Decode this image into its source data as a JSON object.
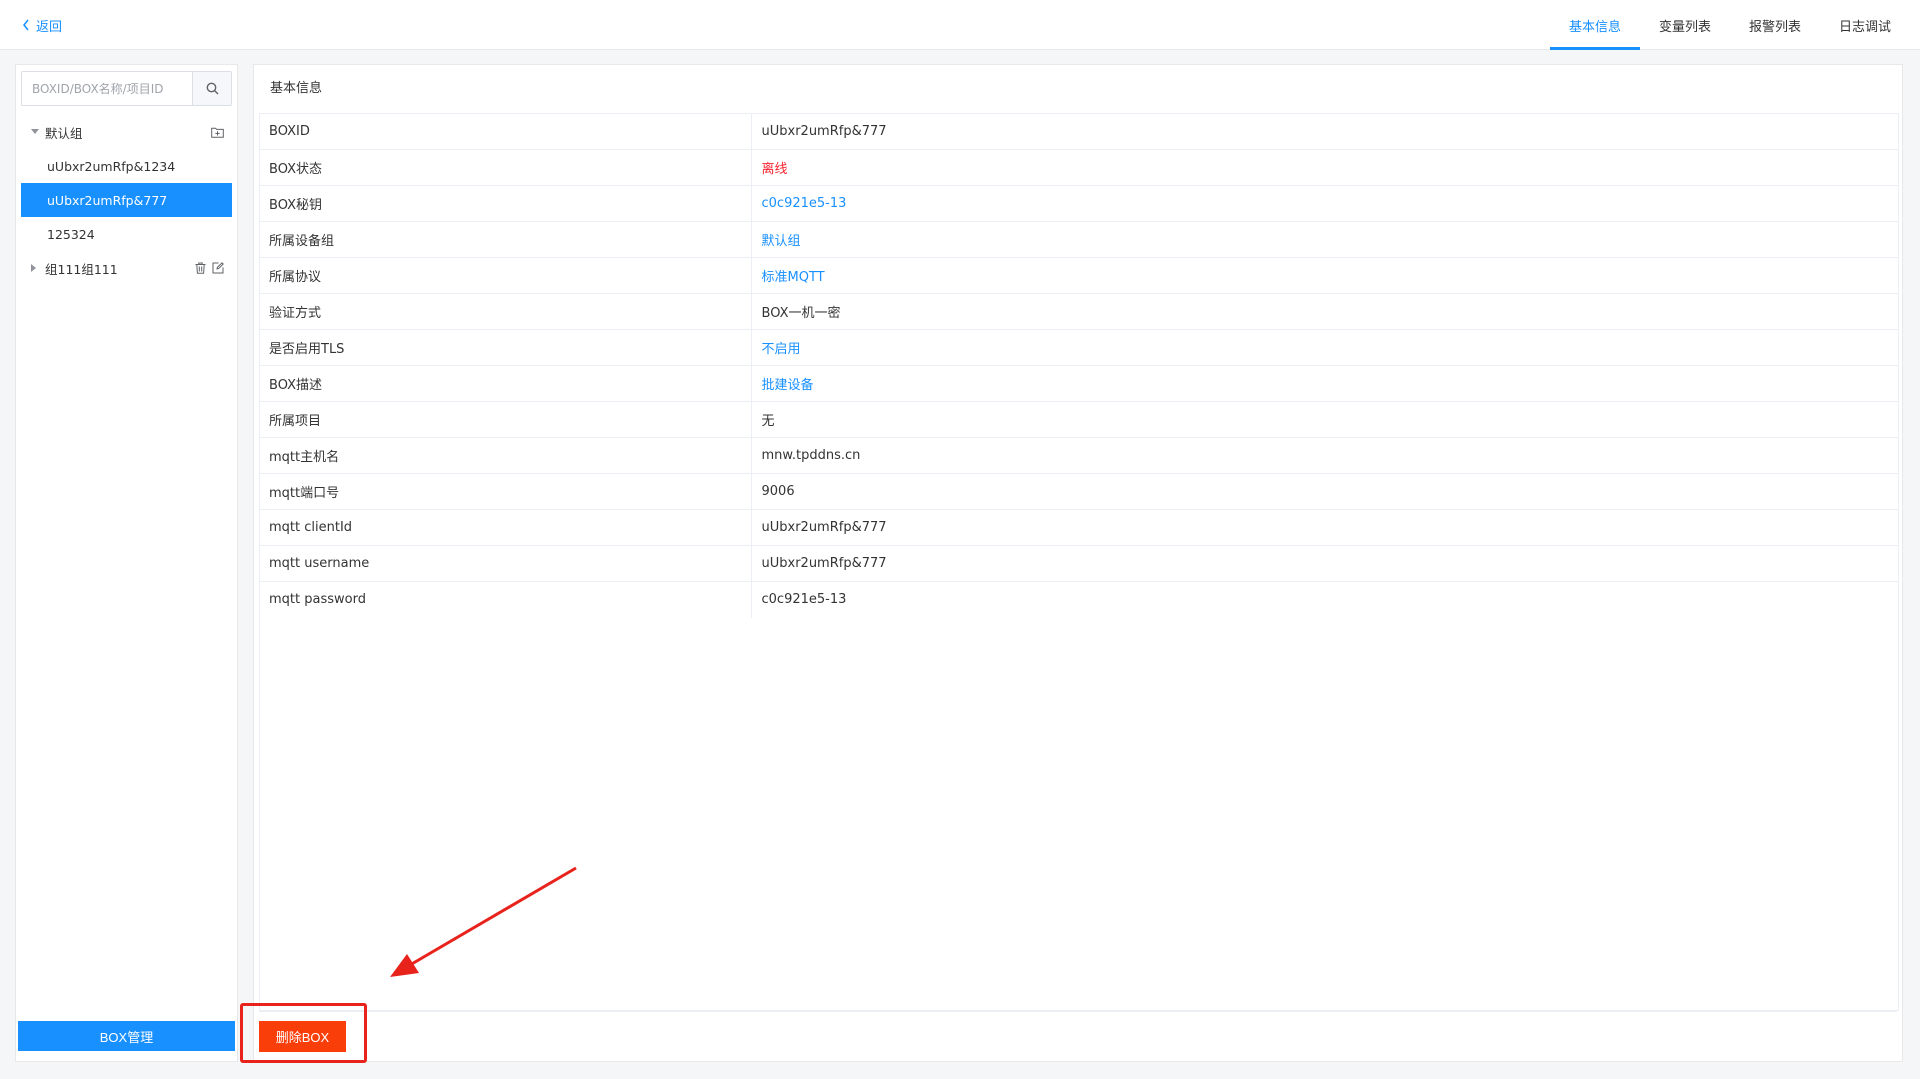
{
  "header": {
    "back_label": "返回",
    "tabs": [
      {
        "label": "基本信息",
        "active": true
      },
      {
        "label": "变量列表",
        "active": false
      },
      {
        "label": "报警列表",
        "active": false
      },
      {
        "label": "日志调试",
        "active": false
      }
    ]
  },
  "sidebar": {
    "search_placeholder": "BOXID/BOX名称/项目ID",
    "tree": [
      {
        "label": "默认组",
        "type": "group",
        "expanded": true
      },
      {
        "label": "uUbxr2umRfp&1234",
        "type": "child",
        "selected": false
      },
      {
        "label": "uUbxr2umRfp&777",
        "type": "child",
        "selected": true
      },
      {
        "label": "125324",
        "type": "child",
        "selected": false
      },
      {
        "label": "组111组111",
        "type": "group",
        "expanded": false
      }
    ],
    "manage_button_label": "BOX管理"
  },
  "main": {
    "section_title": "基本信息",
    "rows": [
      {
        "key": "BOXID",
        "value": "uUbxr2umRfp&777",
        "style": "plain"
      },
      {
        "key": "BOX状态",
        "value": "离线",
        "style": "red"
      },
      {
        "key": "BOX秘钥",
        "value": "c0c921e5-13",
        "style": "link"
      },
      {
        "key": "所属设备组",
        "value": "默认组",
        "style": "link"
      },
      {
        "key": "所属协议",
        "value": "标准MQTT",
        "style": "link"
      },
      {
        "key": "验证方式",
        "value": "BOX一机一密",
        "style": "plain"
      },
      {
        "key": "是否启用TLS",
        "value": "不启用",
        "style": "link"
      },
      {
        "key": "BOX描述",
        "value": "批建设备",
        "style": "link"
      },
      {
        "key": "所属项目",
        "value": "无",
        "style": "plain"
      },
      {
        "key": "mqtt主机名",
        "value": "mnw.tpddns.cn",
        "style": "plain"
      },
      {
        "key": "mqtt端口号",
        "value": "9006",
        "style": "plain"
      },
      {
        "key": "mqtt clientId",
        "value": "uUbxr2umRfp&777",
        "style": "plain"
      },
      {
        "key": "mqtt username",
        "value": "uUbxr2umRfp&777",
        "style": "plain"
      },
      {
        "key": "mqtt password",
        "value": "c0c921e5-13",
        "style": "plain"
      }
    ],
    "delete_button_label": "删除BOX"
  },
  "colors": {
    "accent": "#1890ff",
    "danger": "#fa3e0a",
    "status_offline": "#f5222d",
    "annotation": "#e8231c"
  }
}
